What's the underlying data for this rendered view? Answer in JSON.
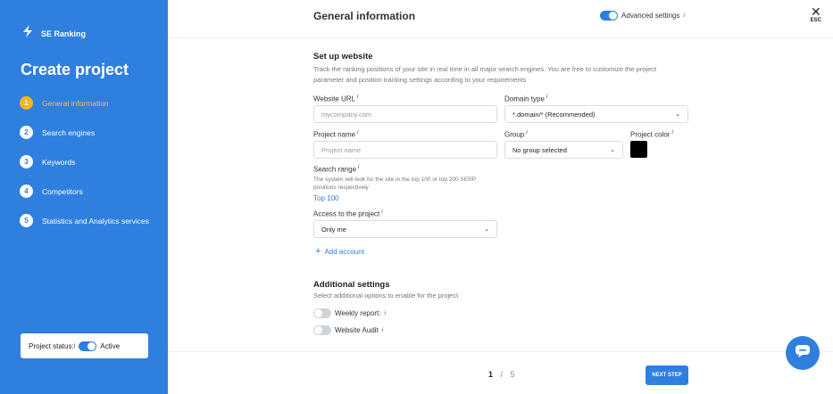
{
  "brand": {
    "name": "SE Ranking"
  },
  "sidebar": {
    "title": "Create project",
    "steps": [
      {
        "num": "1",
        "label": "General information"
      },
      {
        "num": "2",
        "label": "Search engines"
      },
      {
        "num": "3",
        "label": "Keywords"
      },
      {
        "num": "4",
        "label": "Competitors"
      },
      {
        "num": "5",
        "label": "Statistics and Analytics services"
      }
    ],
    "status": {
      "label": "Project status:",
      "info": "i",
      "value": "Active"
    }
  },
  "header": {
    "title": "General information",
    "advanced_label": "Advanced settings",
    "info": "i",
    "close_label": "ESC"
  },
  "setup": {
    "title": "Set up website",
    "description": "Track the ranking positions of your site in real time in all major search engines. You are free to customize the project parameter and position tracking settings according to your requirements",
    "website_url_label": "Website URL",
    "website_url_placeholder": "mycompany.com",
    "domain_type_label": "Domain type",
    "domain_type_value": "*.domain/* (Recommended)",
    "project_name_label": "Project name",
    "project_name_placeholder": "Project name",
    "group_label": "Group",
    "group_value": "No group selected",
    "project_color_label": "Project color",
    "project_color": "#000000",
    "search_range_label": "Search range",
    "search_range_note": "The system will look for the site in the top 100 or top 200 SERP positions respectively",
    "search_range_value": "Top 100",
    "access_label": "Access to the project",
    "access_value": "Only me",
    "add_account_label": "Add account"
  },
  "additional": {
    "title": "Additional settings",
    "description": "Select additional options to enable for the project",
    "weekly_report_label": "Weekly report:",
    "website_audit_label": "Website Audit"
  },
  "footer": {
    "current_step": "1",
    "separator": "/",
    "total_steps": "5",
    "next_label": "NEXT STEP"
  },
  "colors": {
    "accent": "#2f7fdf",
    "active_step": "#f3b71c",
    "sidebar_bg": "#2f7fdf"
  }
}
